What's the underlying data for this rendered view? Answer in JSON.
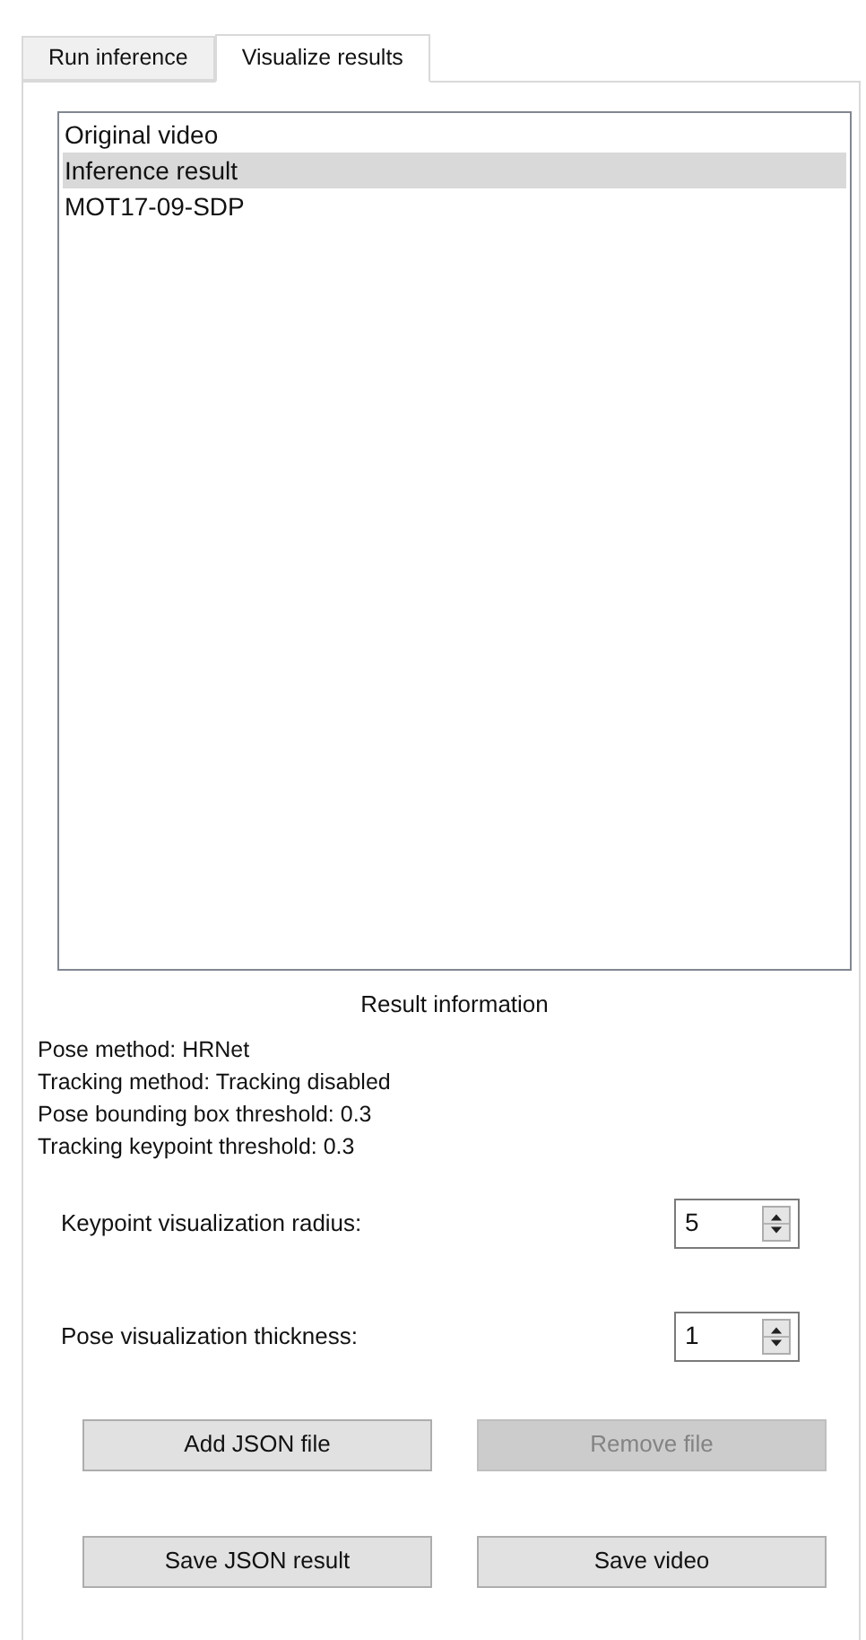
{
  "tabs": [
    {
      "label": "Run inference",
      "selected": false
    },
    {
      "label": "Visualize results",
      "selected": true
    }
  ],
  "results_list": [
    {
      "label": "Original video",
      "selected": false
    },
    {
      "label": "Inference result",
      "selected": true
    },
    {
      "label": "MOT17-09-SDP",
      "selected": false
    }
  ],
  "result_information": {
    "title": "Result information",
    "lines": [
      "Pose method: HRNet",
      "Tracking method: Tracking disabled",
      "Pose bounding box threshold: 0.3",
      "Tracking keypoint threshold: 0.3"
    ]
  },
  "spin_fields": [
    {
      "label": "Keypoint visualization radius:",
      "value": "5"
    },
    {
      "label": "Pose visualization thickness:",
      "value": "1"
    }
  ],
  "buttons": [
    {
      "label": "Add JSON file",
      "disabled": false
    },
    {
      "label": "Remove file",
      "disabled": true
    },
    {
      "label": "Save JSON result",
      "disabled": false
    },
    {
      "label": "Save video",
      "disabled": false
    }
  ]
}
